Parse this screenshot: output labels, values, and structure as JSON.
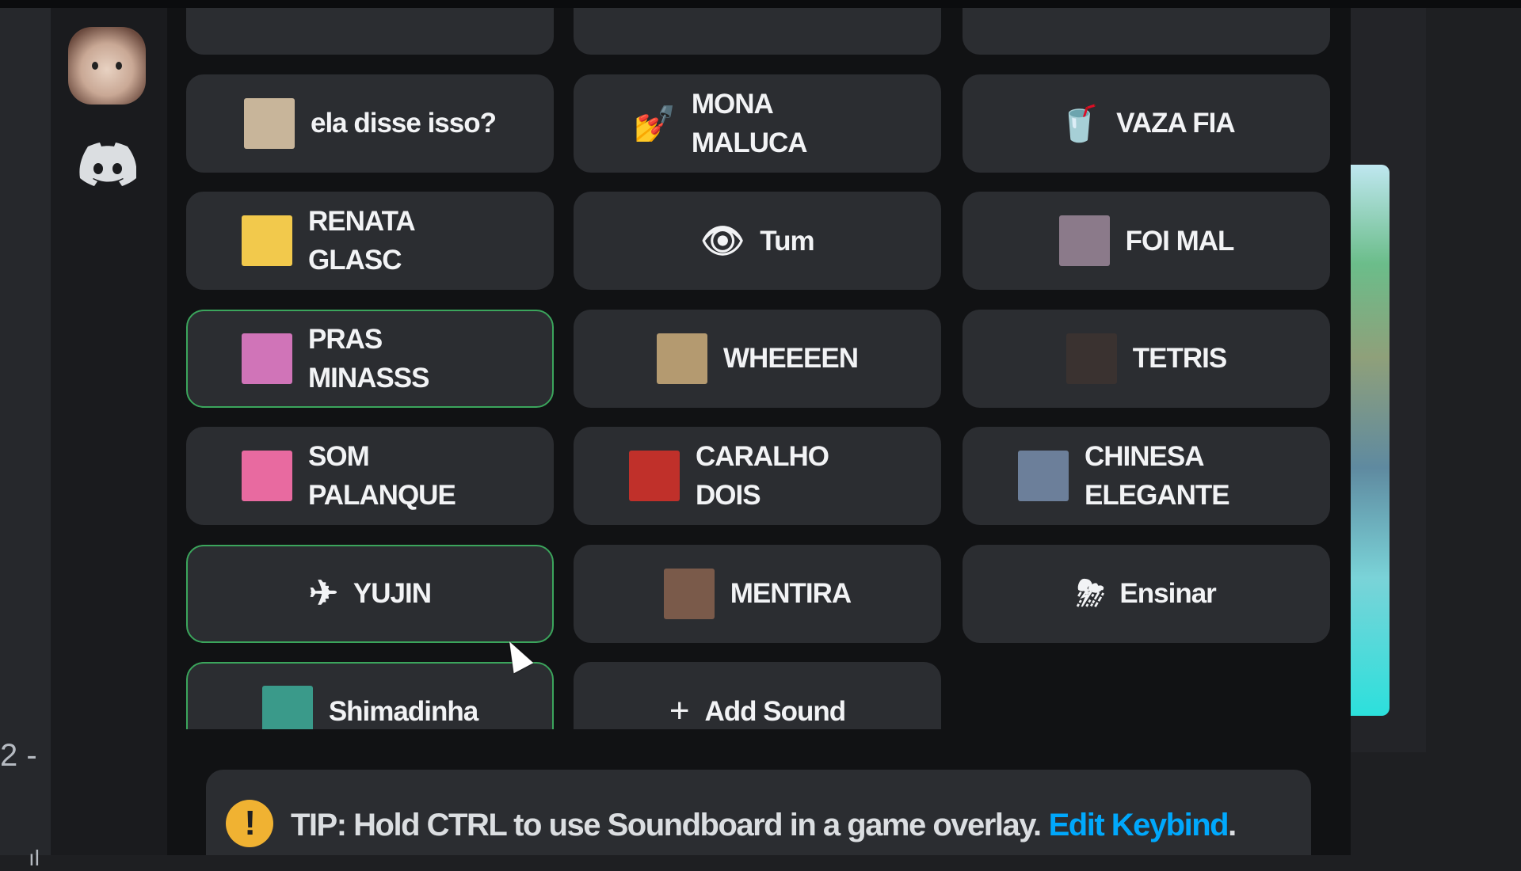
{
  "sidebar": {
    "partial_text": "2 -",
    "partial_icon": "signal-bars-icon"
  },
  "servers": [
    {
      "name": "user-avatar"
    },
    {
      "name": "discord-home-icon"
    }
  ],
  "soundboard": {
    "partial_row": [
      {
        "label": "",
        "icon": "emoji-partial"
      },
      {
        "label": "",
        "icon": "emoji-partial"
      },
      {
        "label": "",
        "icon": "emoji-partial"
      }
    ],
    "sounds": [
      {
        "label": "ela disse isso?",
        "icon": "image-thumbnail",
        "thumb": "#c8b59a",
        "active": false
      },
      {
        "label": "MONA MALUCA",
        "icon": "nail-polish-emoji",
        "glyph": "💅",
        "active": false
      },
      {
        "label": "VAZA FIA",
        "icon": "tropical-drink-emoji",
        "glyph": "🥤",
        "active": false
      },
      {
        "label": "RENATA GLASC",
        "icon": "image-thumbnail",
        "thumb": "#f2c94c",
        "active": false
      },
      {
        "label": "Tum",
        "icon": "eye-emoji",
        "glyph": "👁",
        "active": false
      },
      {
        "label": "FOI MAL",
        "icon": "image-thumbnail",
        "thumb": "#8b7a8a",
        "active": false
      },
      {
        "label": "PRAS MINASSS",
        "icon": "image-thumbnail",
        "thumb": "#d074b8",
        "active": true
      },
      {
        "label": "WHEEEEN",
        "icon": "image-thumbnail",
        "thumb": "#b49a70",
        "active": false
      },
      {
        "label": "TETRIS",
        "icon": "image-thumbnail",
        "thumb": "#3a3230",
        "active": false
      },
      {
        "label": "SOM PALANQUE",
        "icon": "image-thumbnail",
        "thumb": "#e86aa0",
        "active": false
      },
      {
        "label": "CARALHO DOIS",
        "icon": "image-thumbnail",
        "thumb": "#c0302a",
        "active": false
      },
      {
        "label": "CHINESA ELEGANTE",
        "icon": "image-thumbnail",
        "thumb": "#6c7f9a",
        "active": false
      },
      {
        "label": "YUJIN",
        "icon": "airplane-emoji",
        "glyph": "✈",
        "active": true
      },
      {
        "label": "MENTIRA",
        "icon": "image-thumbnail",
        "thumb": "#7a5a4a",
        "active": false
      },
      {
        "label": "Ensinar",
        "icon": "thunder-cloud-emoji",
        "glyph": "⛈",
        "active": false
      },
      {
        "label": "Shimadinha",
        "icon": "image-thumbnail",
        "thumb": "#3a9a8a",
        "active": true
      }
    ],
    "add_sound": {
      "label": "Add Sound",
      "icon": "plus-icon"
    }
  },
  "tip": {
    "prefix": "TIP:",
    "text": "Hold CTRL to use Soundboard in a game overlay.",
    "link": "Edit Keybind",
    "suffix": "."
  },
  "colors": {
    "accent_active": "#3ba55c",
    "link": "#00a8fc",
    "warning": "#f0b232",
    "button_bg": "#2b2d31"
  }
}
